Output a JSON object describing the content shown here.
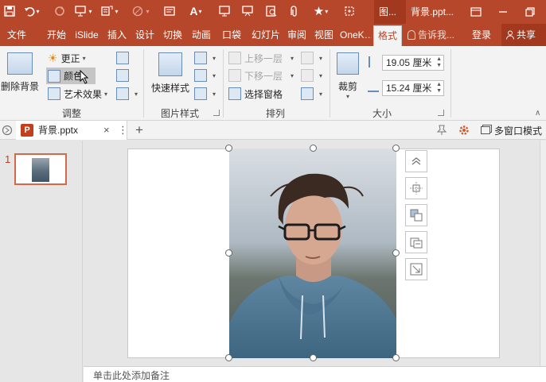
{
  "title_bar": {
    "context_tab_label": "图...",
    "document_title": "背景.ppt..."
  },
  "ribbon_tabs": {
    "file": "文件",
    "home": "开始",
    "islide": "iSlide",
    "insert": "插入",
    "design": "设计",
    "transitions": "切换",
    "animations": "动画",
    "pocket_animation": "口袋",
    "slideshow": "幻灯片",
    "review": "审阅",
    "view": "视图",
    "onekey": "OneK…",
    "format": "格式",
    "tell_me": "告诉我...",
    "sign_in": "登录",
    "share": "共享"
  },
  "ribbon": {
    "adjust": {
      "remove_background": "删除背景",
      "corrections": "更正",
      "color": "颜色",
      "artistic_effects": "艺术效果",
      "group_label": "调整"
    },
    "picture_styles": {
      "quick_styles": "快速样式",
      "group_label": "图片样式"
    },
    "arrange": {
      "bring_forward": "上移一层",
      "send_backward": "下移一层",
      "selection_pane": "选择窗格",
      "group_label": "排列"
    },
    "size": {
      "crop": "裁剪",
      "height_value": "19.05 厘米",
      "width_value": "15.24 厘米",
      "group_label": "大小"
    }
  },
  "doc_tabs": {
    "file_name": "背景.pptx",
    "close_glyph": "×",
    "new_tab_glyph": "+",
    "multi_window_label": "多窗口模式"
  },
  "thumbnails": {
    "slide_number": "1"
  },
  "notes": {
    "placeholder": "单击此处添加备注"
  }
}
